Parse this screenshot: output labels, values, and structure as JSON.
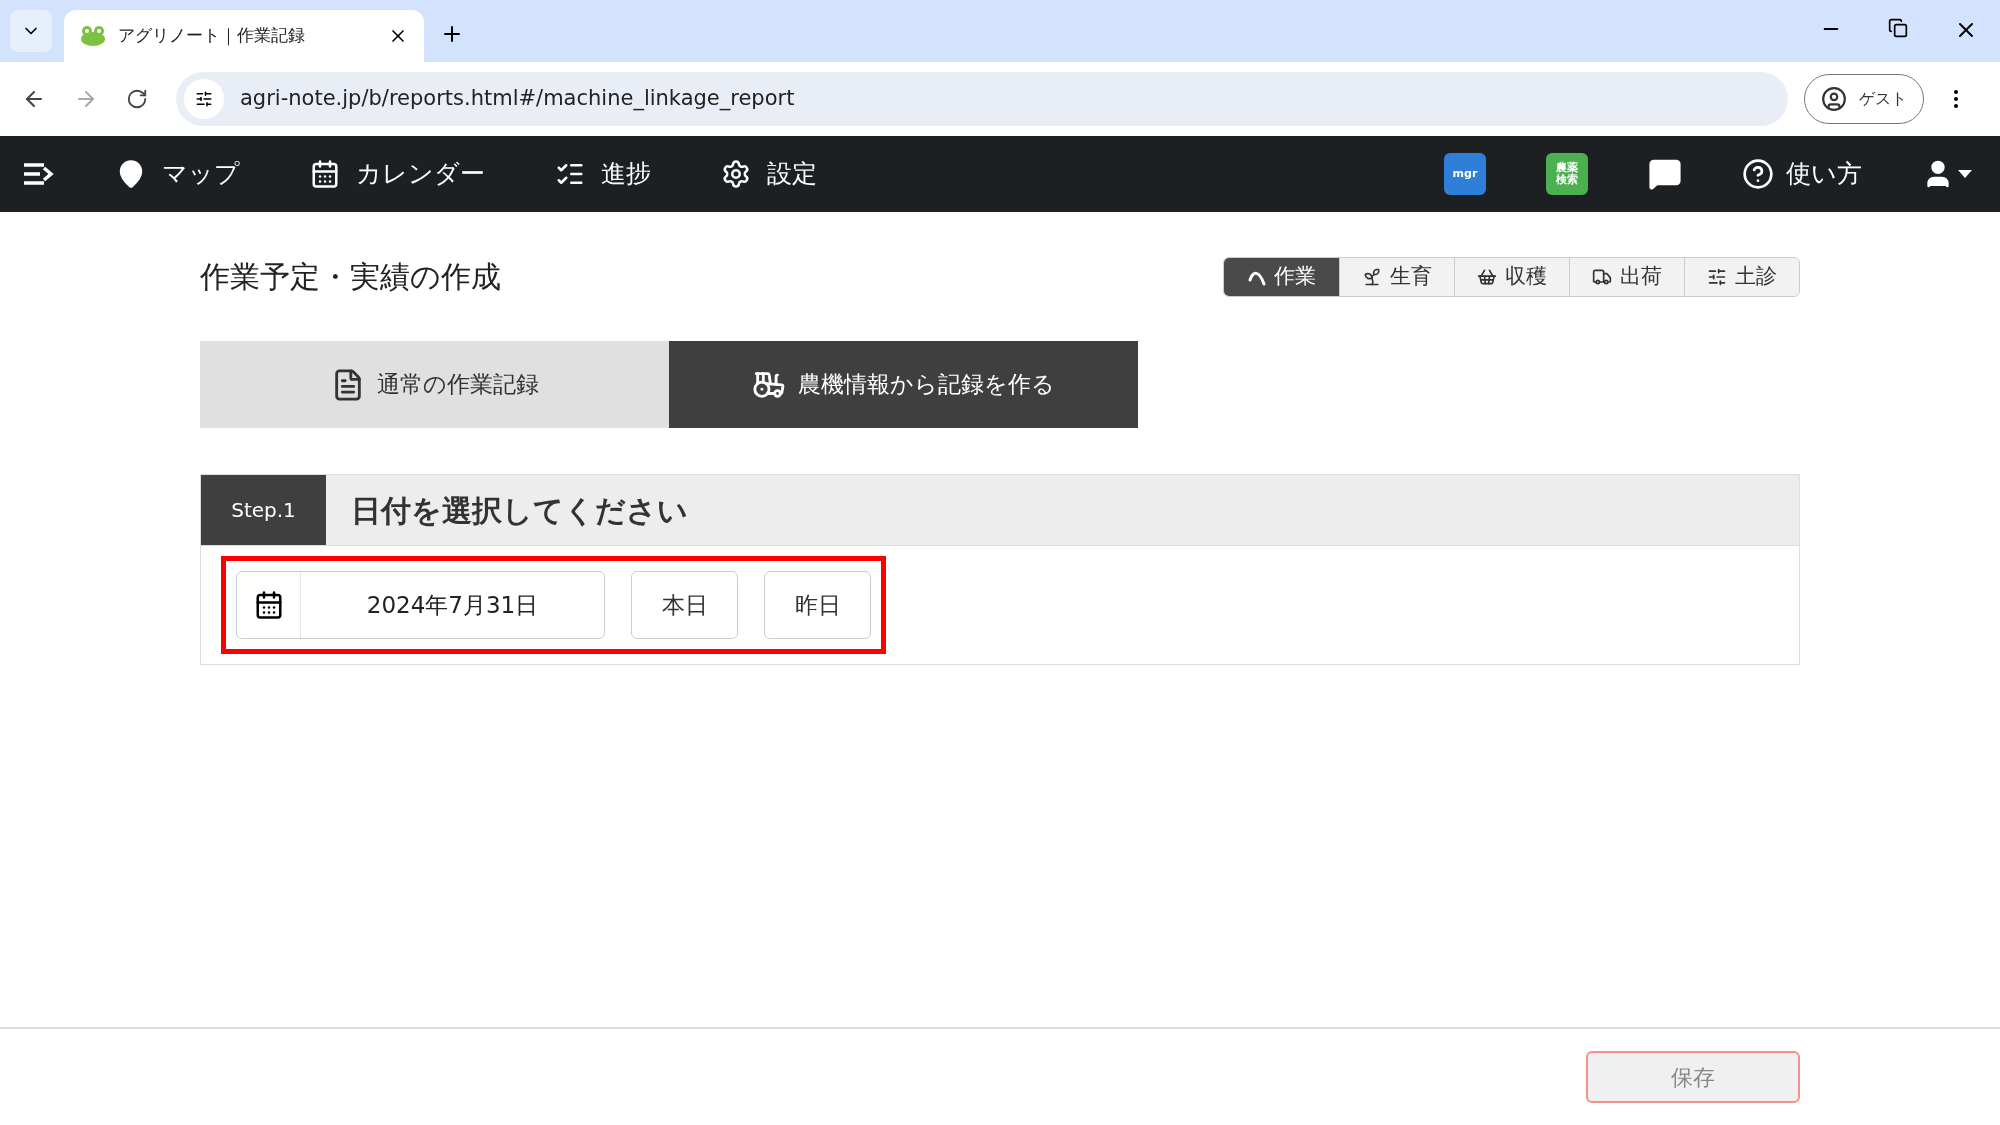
{
  "browser": {
    "tabs": [
      {
        "title": "アグリノート｜作業記録",
        "selected": true
      }
    ],
    "url": "agri-note.jp/b/reports.html#/machine_linkage_report",
    "profile": "ゲスト"
  },
  "navbar": {
    "items": [
      {
        "label": "マップ"
      },
      {
        "label": "カレンダー"
      },
      {
        "label": "進捗"
      },
      {
        "label": "設定"
      }
    ],
    "app_icons": [
      {
        "label": "mgr",
        "color": "#2f7fd8"
      },
      {
        "label": "農薬検索",
        "color": "#4caf50"
      }
    ],
    "help": "使い方"
  },
  "page": {
    "title": "作業予定・実績の作成",
    "segments": [
      {
        "label": "作業",
        "selected": true
      },
      {
        "label": "生育",
        "selected": false
      },
      {
        "label": "収穫",
        "selected": false
      },
      {
        "label": "出荷",
        "selected": false
      },
      {
        "label": "土診",
        "selected": false
      }
    ],
    "mode_tabs": [
      {
        "label": "通常の作業記録",
        "selected": false
      },
      {
        "label": "農機情報から記録を作る",
        "selected": true
      }
    ],
    "step": {
      "badge": "Step.1",
      "heading": "日付を選択してください",
      "date": "2024年7月31日",
      "buttons": [
        "本日",
        "昨日"
      ],
      "highlighted": true
    }
  },
  "footer": {
    "save": {
      "label": "保存",
      "disabled": true
    }
  }
}
